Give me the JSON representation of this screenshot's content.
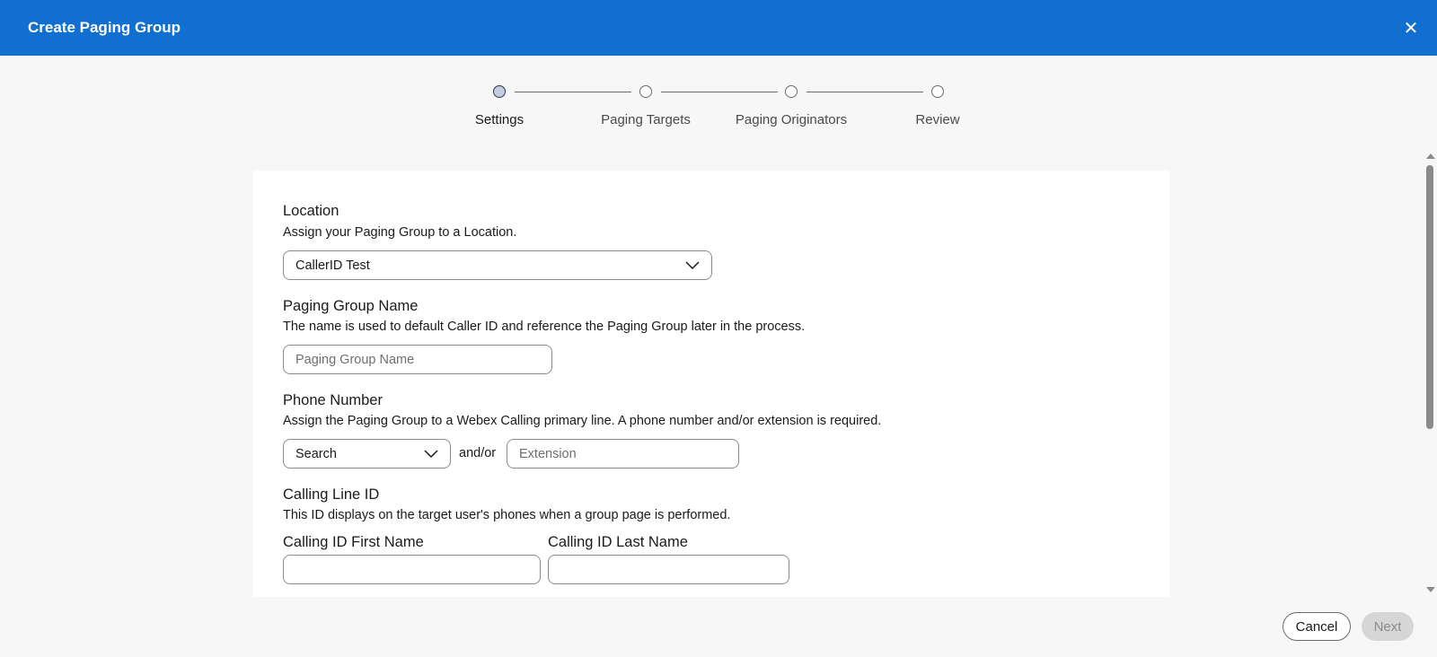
{
  "header": {
    "title": "Create Paging Group",
    "close_label": "✕"
  },
  "stepper": {
    "steps": [
      {
        "label": "Settings",
        "active": true
      },
      {
        "label": "Paging Targets",
        "active": false
      },
      {
        "label": "Paging Originators",
        "active": false
      },
      {
        "label": "Review",
        "active": false
      }
    ]
  },
  "form": {
    "location": {
      "title": "Location",
      "description": "Assign your Paging Group to a Location.",
      "value": "CallerID Test"
    },
    "group_name": {
      "title": "Paging Group Name",
      "description": "The name is used to default Caller ID and reference the Paging Group later in the process.",
      "placeholder": "Paging Group Name",
      "value": ""
    },
    "phone_number": {
      "title": "Phone Number",
      "description": "Assign the Paging Group to a Webex Calling primary line. A phone number and/or extension is required.",
      "search_value": "Search",
      "and_or": "and/or",
      "extension_placeholder": "Extension"
    },
    "calling_line_id": {
      "title": "Calling Line ID",
      "description": "This ID displays on the target user's phones when a group page is performed.",
      "first_name_label": "Calling ID First Name",
      "last_name_label": "Calling ID Last Name",
      "first_name_value": "",
      "last_name_value": ""
    }
  },
  "footer": {
    "cancel_label": "Cancel",
    "next_label": "Next"
  },
  "colors": {
    "header": "#1170cf",
    "background": "#f7f7f7",
    "card": "#ffffff"
  }
}
